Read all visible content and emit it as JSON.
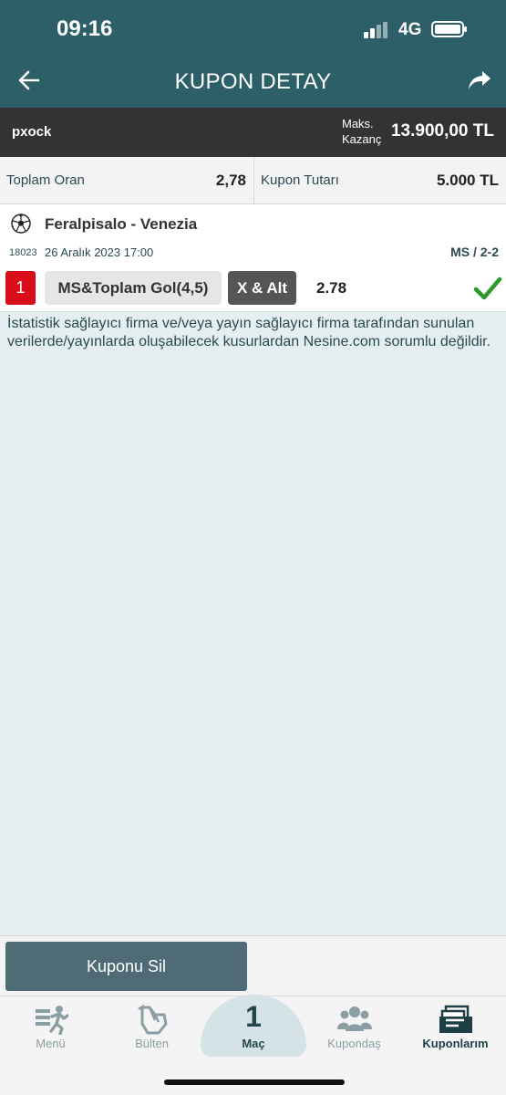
{
  "status_bar": {
    "time": "09:16",
    "network": "4G"
  },
  "nav": {
    "title": "KUPON DETAY"
  },
  "user_bar": {
    "username": "pxock",
    "max_win_label": "Maks.\nKazanç",
    "max_win_line1": "Maks.",
    "max_win_line2": "Kazanç",
    "max_win_value": "13.900,00 TL"
  },
  "totals": {
    "total_odds_label": "Toplam Oran",
    "total_odds_value": "2,78",
    "coupon_amount_label": "Kupon Tutarı",
    "coupon_amount_value": "5.000 TL"
  },
  "match": {
    "teams": "Feralpisalo - Venezia",
    "code": "18023",
    "date": "26 Aralık 2023 17:00",
    "result": "MS / 2-2",
    "number": "1",
    "market": "MS&Toplam Gol(4,5)",
    "pick": "X & Alt",
    "odd": "2.78",
    "status": "won"
  },
  "disclaimer": "İstatistik sağlayıcı firma ve/veya yayın sağlayıcı firma tarafından sunulan verilerde/yayınlarda oluşabilecek kusurlardan Nesine.com sorumlu değildir.",
  "actions": {
    "delete_label": "Kuponu Sil"
  },
  "tabs": [
    {
      "label": "Menü",
      "icon": "menu-runner-icon"
    },
    {
      "label": "Bülten",
      "icon": "bulletin-hand-icon"
    },
    {
      "label": "Maç",
      "count": "1"
    },
    {
      "label": "Kupondaş",
      "icon": "users-icon"
    },
    {
      "label": "Kuponlarım",
      "icon": "coupons-icon"
    }
  ],
  "colors": {
    "header": "#2c5f68",
    "accent_red": "#d90e1a",
    "success_green": "#2e9a2a",
    "button": "#4f6c76"
  }
}
